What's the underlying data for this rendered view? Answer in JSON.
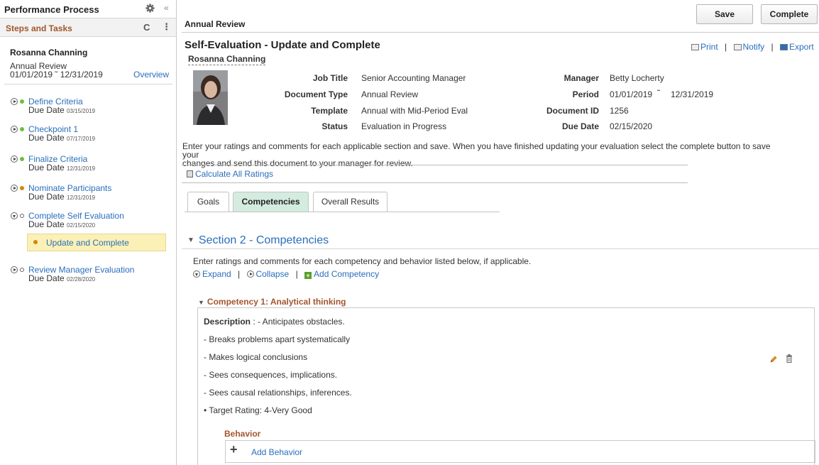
{
  "sidebar": {
    "title": "Performance Process",
    "collapse_glyph": "«",
    "steps_label": "Steps and Tasks",
    "refresh_glyph": "C",
    "more_glyph": "⋮",
    "person": "Rosanna Channing",
    "document": "Annual Review",
    "period": "01/01/2019 ˜ 12/31/2019",
    "overview_link": "Overview",
    "steps": [
      {
        "name": "Define Criteria",
        "due_label": "Due Date",
        "due": "03/15/2019",
        "status_color": "#6abf3b"
      },
      {
        "name": "Checkpoint 1",
        "due_label": "Due Date",
        "due": "07/17/2019",
        "status_color": "#6abf3b"
      },
      {
        "name": "Finalize Criteria",
        "due_label": "Due Date",
        "due": "12/31/2019",
        "status_color": "#6abf3b"
      },
      {
        "name": "Nominate Participants",
        "due_label": "Due Date",
        "due": "12/31/2019",
        "status_color": "#d4860b"
      },
      {
        "name": "Complete Self Evaluation",
        "due_label": "Due Date",
        "due": "02/15/2020",
        "status_color": "#ffffff"
      },
      {
        "name": "Review Manager Evaluation",
        "due_label": "Due Date",
        "due": "02/28/2020",
        "status_color": "#ffffff"
      }
    ],
    "current_task": "Update and Complete"
  },
  "header": {
    "breadcrumb": "Annual Review",
    "save_label": "Save",
    "complete_label": "Complete"
  },
  "document": {
    "title": "Self-Evaluation - Update and Complete",
    "employee": "Rosanna Channing",
    "links": {
      "print": "Print",
      "notify": "Notify",
      "export": "Export"
    },
    "fields": {
      "job_title_label": "Job Title",
      "job_title": "Senior Accounting Manager",
      "doc_type_label": "Document Type",
      "doc_type": "Annual Review",
      "template_label": "Template",
      "template": "Annual with Mid-Period Eval",
      "status_label": "Status",
      "status": "Evaluation in Progress",
      "manager_label": "Manager",
      "manager": "Betty Locherty",
      "period_label": "Period",
      "period_start": "01/01/2019",
      "period_sep": "˜",
      "period_end": "12/31/2019",
      "docid_label": "Document ID",
      "docid": "1256",
      "due_label": "Due Date",
      "due": "02/15/2020"
    },
    "instructions_1": "Enter your ratings and comments for each applicable section and save. When you have finished updating your evaluation select the complete button to save your",
    "instructions_2": "changes and send this document to your manager for review.",
    "calc_link": "Calculate All Ratings"
  },
  "tabs": [
    "Goals",
    "Competencies",
    "Overall Results"
  ],
  "section": {
    "title": "Section 2 - Competencies",
    "desc": "Enter ratings and comments for each competency and behavior listed below, if applicable.",
    "expand": "Expand",
    "collapse": "Collapse",
    "add_competency": "Add Competency"
  },
  "competency": {
    "title": "Competency 1: Analytical thinking",
    "desc_label": "Description",
    "desc_first": " : - Anticipates obstacles.",
    "lines": [
      "- Breaks problems apart systematically",
      "- Makes logical conclusions",
      "- Sees consequences, implications.",
      "- Sees causal relationships, inferences."
    ],
    "target": "Target Rating: 4-Very Good",
    "behavior_label": "Behavior",
    "add_behavior": "Add Behavior"
  }
}
